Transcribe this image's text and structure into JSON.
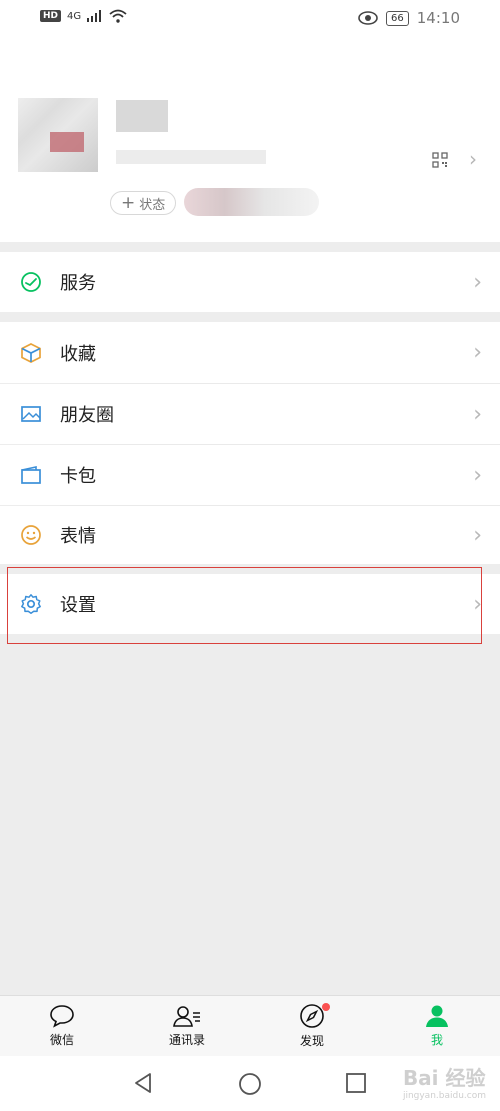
{
  "status_bar": {
    "hd": "HD",
    "signal": "4G",
    "battery": "66",
    "time": "14:10"
  },
  "profile": {
    "status_label": "状态"
  },
  "menu": {
    "services": "服务",
    "favorites": "收藏",
    "moments": "朋友圈",
    "cards": "卡包",
    "stickers": "表情",
    "settings": "设置"
  },
  "tabs": [
    {
      "label": "微信"
    },
    {
      "label": "通讯录"
    },
    {
      "label": "发现"
    },
    {
      "label": "我"
    }
  ],
  "watermark": {
    "main": "Bai 经验",
    "sub": "jingyan.baidu.com"
  },
  "colors": {
    "accent": "#07c160",
    "badge": "#fa5151",
    "highlight": "#d9413c"
  }
}
